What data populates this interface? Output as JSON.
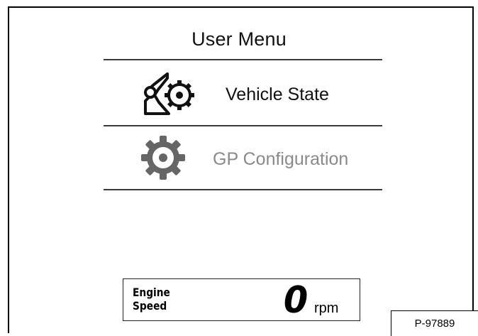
{
  "menu": {
    "title": "User Menu",
    "items": [
      {
        "label": "Vehicle State",
        "icon": "vehicle-state-icon",
        "enabled": true,
        "color": "#111111"
      },
      {
        "label": "GP Configuration",
        "icon": "gear-icon",
        "enabled": false,
        "color": "#8a8a8a"
      }
    ]
  },
  "engine": {
    "label_line1": "Engine",
    "label_line2": "Speed",
    "value": "0",
    "unit": "rpm"
  },
  "figure_ref": "P-97889"
}
